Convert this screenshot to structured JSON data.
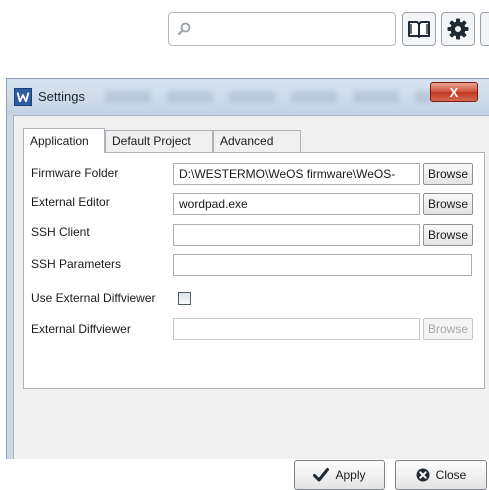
{
  "toolbar": {
    "search_placeholder": "",
    "icons": [
      "search-icon",
      "book-icon",
      "gear-icon"
    ]
  },
  "window": {
    "title": "Settings",
    "close_label": "X",
    "title_color": "#c9d7e6",
    "close_color": "#c2381f"
  },
  "tabs": [
    {
      "label": "Application",
      "active": true
    },
    {
      "label": "Default Project",
      "active": false
    },
    {
      "label": "Advanced",
      "active": false
    }
  ],
  "form": {
    "firmware_folder": {
      "label": "Firmware Folder",
      "value": "D:\\WESTERMO\\WeOS firmware\\WeOS-",
      "button": "Browse"
    },
    "external_editor": {
      "label": "External Editor",
      "value": "wordpad.exe",
      "button": "Browse"
    },
    "ssh_client": {
      "label": "SSH Client",
      "value": "",
      "button": "Browse"
    },
    "ssh_parameters": {
      "label": "SSH Parameters",
      "value": ""
    },
    "use_external_diffviewer": {
      "label": "Use External Diffviewer",
      "checked": false
    },
    "external_diffviewer": {
      "label": "External Diffviewer",
      "value": "",
      "button": "Browse",
      "enabled": false
    }
  },
  "buttons": {
    "apply": "Apply",
    "close": "Close",
    "apply_icon": "checkmark-icon",
    "close_icon": "close-circle-icon"
  }
}
